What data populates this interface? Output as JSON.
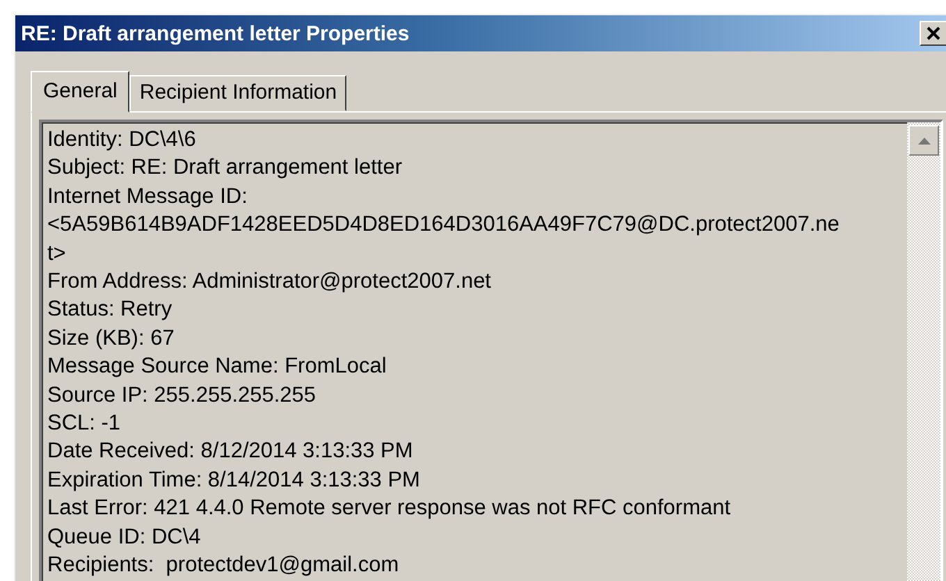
{
  "window": {
    "title": "RE: Draft arrangement letter Properties"
  },
  "tabs": [
    {
      "label": "General",
      "selected": true
    },
    {
      "label": "Recipient Information",
      "selected": false
    }
  ],
  "details": {
    "lines": [
      "Identity: DC\\4\\6",
      "Subject: RE: Draft arrangement letter",
      "Internet Message ID:",
      "<5A59B614B9ADF1428EED5D4D8ED164D3016AA49F7C79@DC.protect2007.ne",
      "t>",
      "From Address: Administrator@protect2007.net",
      "Status: Retry",
      "Size (KB): 67",
      "Message Source Name: FromLocal",
      "Source IP: 255.255.255.255",
      "SCL: -1",
      "Date Received: 8/12/2014 3:13:33 PM",
      "Expiration Time: 8/14/2014 3:13:33 PM",
      "Last Error: 421 4.4.0 Remote server response was not RFC conformant",
      "Queue ID: DC\\4",
      "Recipients:  protectdev1@gmail.com"
    ]
  }
}
